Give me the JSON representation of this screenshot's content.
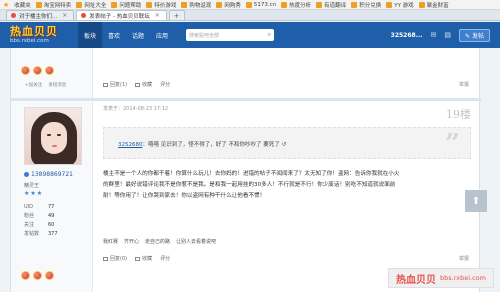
{
  "favbar": {
    "label": "收藏夹",
    "items": [
      "淘宝网特卖",
      "网址大全",
      "问题帮助",
      "特价游戏",
      "购物返现",
      "网购秀",
      "5173.cn",
      "热度分析",
      "有道翻译",
      "积分兑换",
      "YY 游戏",
      "聚金财富"
    ]
  },
  "tabs": [
    {
      "label": "对于楼主你们..."
    },
    {
      "label": "发表帖子 - 热血贝贝联坛"
    }
  ],
  "header": {
    "logo_main": "热血贝贝",
    "logo_url": "bbs.rxbei.com",
    "nav": [
      "板块",
      "喜欢",
      "话题",
      "应用"
    ],
    "search_placeholder": "搜索贴吧全部",
    "username": "325268...",
    "post_button": "发帖"
  },
  "prev_post": {
    "links": [
      "+加关注",
      "发短消息"
    ],
    "actions": [
      "回复(1)",
      "收藏",
      "评分"
    ],
    "report": "举报"
  },
  "user": {
    "name": "13898869721",
    "rank": "精灵王",
    "stars": 3,
    "stats": [
      {
        "k": "UID",
        "v": "77"
      },
      {
        "k": "粉丝",
        "v": "49"
      },
      {
        "k": "关注",
        "v": "60"
      },
      {
        "k": "发帖数",
        "v": "377"
      }
    ],
    "links": [
      "+加关注",
      "发短消息"
    ]
  },
  "post": {
    "meta": "发表于：2014-08-23 17:12",
    "floor": "19楼",
    "quote_user": "3252680",
    "quote_text": "嘻嘻 见识到了，怪不得了，好了  不和你吵吵了  要死了",
    "body": "楼主不是一个人的你都干着！你算什么玩儿！去你妈的！进错的帖子不闻闻来了？太无知了你！盗网：告诉你我就在小火的群里！最好说错评论我不是你惹不是我。是和我一起用挂的30多人！不行就是不行！你少废话！别吃不知道就说面前耐！等你用了！让你哭到家去！你以盗网有种干什么让他看不惯！",
    "footer_links": [
      "我红赛",
      "齐开心",
      "走自己的路",
      "让别人去看着说吧"
    ],
    "actions": [
      "回复(0)",
      "收藏",
      "评分"
    ],
    "report": "举报"
  },
  "watermark": {
    "cn": "热血贝贝",
    "url": "bbs.rxbei.com"
  }
}
